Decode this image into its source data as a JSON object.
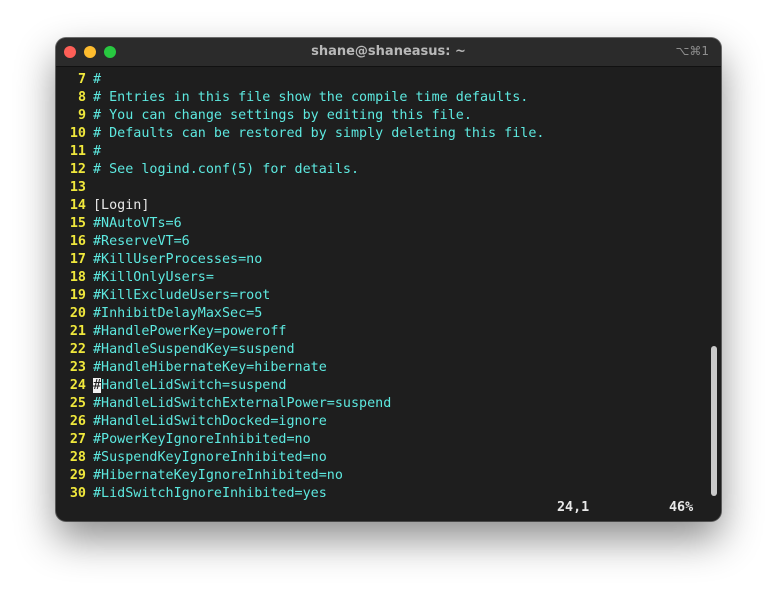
{
  "window": {
    "title": "shane@shaneasus: ~",
    "shortcut": "⌥⌘1"
  },
  "editor": {
    "lines": [
      {
        "num": "7",
        "text": "#",
        "comment": true
      },
      {
        "num": "8",
        "text": "# Entries in this file show the compile time defaults.",
        "comment": true
      },
      {
        "num": "9",
        "text": "# You can change settings by editing this file.",
        "comment": true
      },
      {
        "num": "10",
        "text": "# Defaults can be restored by simply deleting this file.",
        "comment": true
      },
      {
        "num": "11",
        "text": "#",
        "comment": true
      },
      {
        "num": "12",
        "text": "# See logind.conf(5) for details.",
        "comment": true
      },
      {
        "num": "13",
        "text": "",
        "comment": false
      },
      {
        "num": "14",
        "text": "[Login]",
        "comment": false
      },
      {
        "num": "15",
        "text": "#NAutoVTs=6",
        "comment": true
      },
      {
        "num": "16",
        "text": "#ReserveVT=6",
        "comment": true
      },
      {
        "num": "17",
        "text": "#KillUserProcesses=no",
        "comment": true
      },
      {
        "num": "18",
        "text": "#KillOnlyUsers=",
        "comment": true
      },
      {
        "num": "19",
        "text": "#KillExcludeUsers=root",
        "comment": true
      },
      {
        "num": "20",
        "text": "#InhibitDelayMaxSec=5",
        "comment": true
      },
      {
        "num": "21",
        "text": "#HandlePowerKey=poweroff",
        "comment": true
      },
      {
        "num": "22",
        "text": "#HandleSuspendKey=suspend",
        "comment": true
      },
      {
        "num": "23",
        "text": "#HandleHibernateKey=hibernate",
        "comment": true
      },
      {
        "num": "24",
        "text": "#HandleLidSwitch=suspend",
        "comment": true,
        "cursor": true
      },
      {
        "num": "25",
        "text": "#HandleLidSwitchExternalPower=suspend",
        "comment": true
      },
      {
        "num": "26",
        "text": "#HandleLidSwitchDocked=ignore",
        "comment": true
      },
      {
        "num": "27",
        "text": "#PowerKeyIgnoreInhibited=no",
        "comment": true
      },
      {
        "num": "28",
        "text": "#SuspendKeyIgnoreInhibited=no",
        "comment": true
      },
      {
        "num": "29",
        "text": "#HibernateKeyIgnoreInhibited=no",
        "comment": true
      },
      {
        "num": "30",
        "text": "#LidSwitchIgnoreInhibited=yes",
        "comment": true
      }
    ]
  },
  "status": {
    "position": "24,1",
    "percent": "46%"
  },
  "scroll": {
    "position_fraction": 0.46
  },
  "colors": {
    "line_number": "#f0e83c",
    "comment": "#5de9e0",
    "text": "#e8e8e8",
    "background": "#1e1e1e"
  }
}
